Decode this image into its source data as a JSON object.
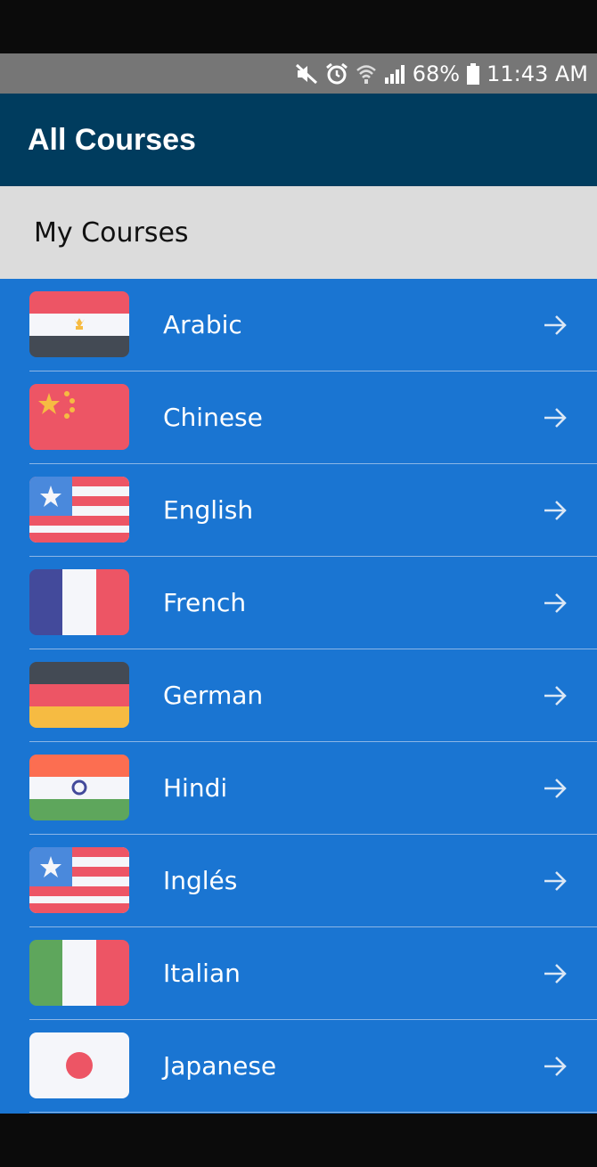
{
  "status_bar": {
    "icons": [
      "mute-icon",
      "alarm-icon",
      "wifi-icon",
      "signal-icon",
      "battery-icon"
    ],
    "battery": "68%",
    "time": "11:43 AM"
  },
  "app_bar": {
    "title": "All Courses"
  },
  "section": {
    "title": "My Courses"
  },
  "colors": {
    "app_bar": "#003c5e",
    "list_background": "#1a75d2",
    "section_header": "#dcdcdc",
    "status_bar": "#767676"
  },
  "courses": [
    {
      "label": "Arabic",
      "flag": "egypt-flag-icon"
    },
    {
      "label": "Chinese",
      "flag": "china-flag-icon"
    },
    {
      "label": "English",
      "flag": "usa-flag-icon"
    },
    {
      "label": "French",
      "flag": "france-flag-icon"
    },
    {
      "label": "German",
      "flag": "germany-flag-icon"
    },
    {
      "label": "Hindi",
      "flag": "india-flag-icon"
    },
    {
      "label": "Inglés",
      "flag": "usa-flag-icon"
    },
    {
      "label": "Italian",
      "flag": "italy-flag-icon"
    },
    {
      "label": "Japanese",
      "flag": "japan-flag-icon"
    }
  ]
}
